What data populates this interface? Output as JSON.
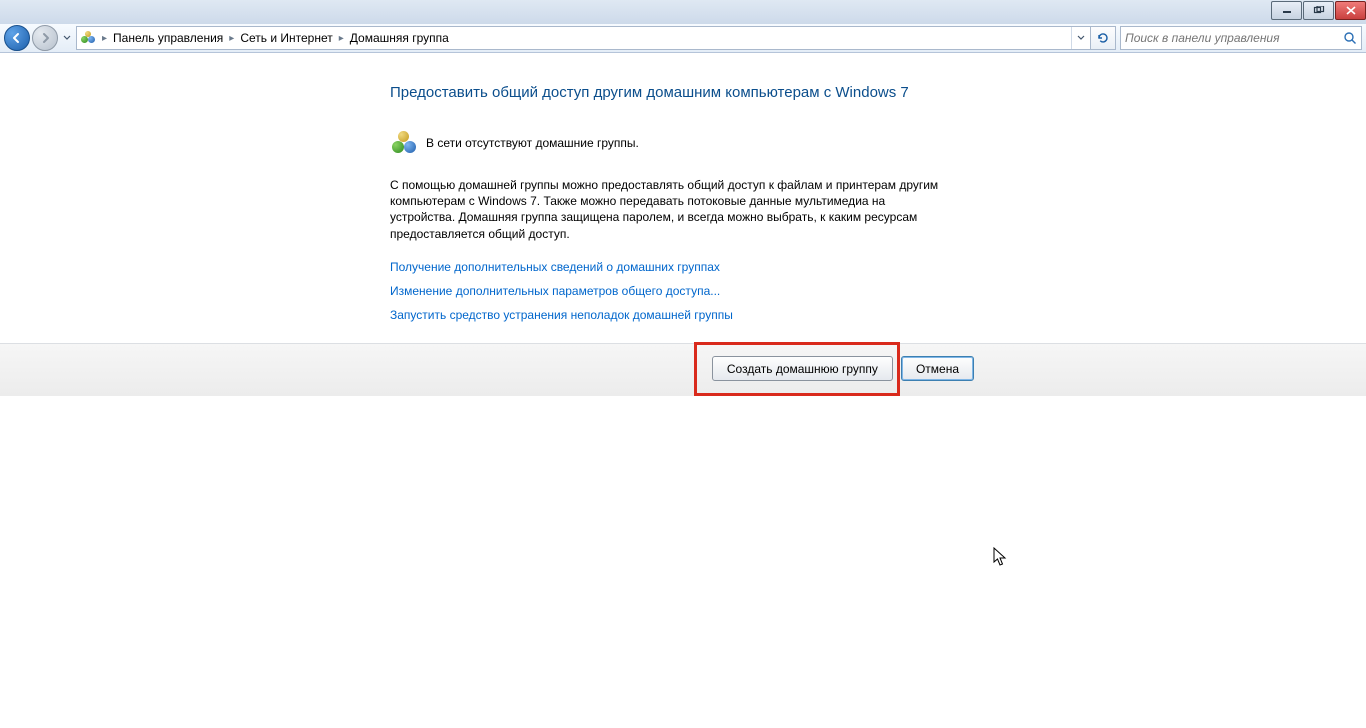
{
  "breadcrumb": {
    "items": [
      "Панель управления",
      "Сеть и Интернет",
      "Домашняя группа"
    ]
  },
  "search": {
    "placeholder": "Поиск в панели управления"
  },
  "page": {
    "title": "Предоставить общий доступ другим домашним компьютерам с Windows 7",
    "status": "В сети отсутствуют домашние группы.",
    "description": "С помощью домашней группы можно предоставлять общий доступ к файлам и принтерам другим компьютерам с Windows 7. Также можно передавать потоковые данные мультимедиа на устройства. Домашняя группа защищена паролем, и всегда можно выбрать, к каким ресурсам предоставляется общий доступ.",
    "links": {
      "learn_more": "Получение дополнительных сведений о домашних группах",
      "advanced_sharing": "Изменение дополнительных параметров общего доступа...",
      "troubleshooter": "Запустить средство устранения неполадок домашней группы"
    }
  },
  "footer": {
    "create_label": "Создать домашнюю группу",
    "cancel_label": "Отмена"
  }
}
